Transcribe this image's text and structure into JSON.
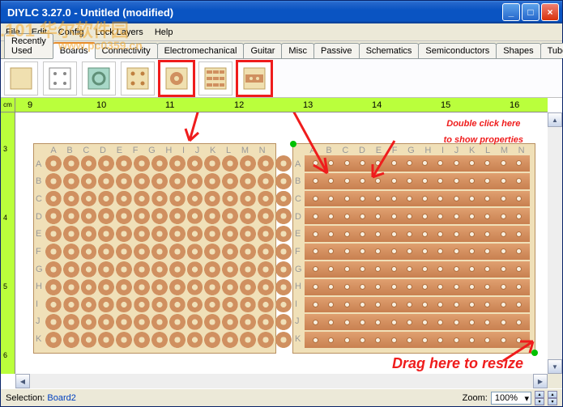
{
  "window": {
    "title": "DIYLC 3.27.0 - Untitled  (modified)"
  },
  "watermark": ".101 华尔软件园",
  "url_watermark": "www.pc0359.cn",
  "menu": [
    "File",
    "Edit",
    "Config",
    "Lock Layers",
    "Help"
  ],
  "tabs": [
    "Recently Used",
    "Boards",
    "Connectivity",
    "Electromechanical",
    "Guitar",
    "Misc",
    "Passive",
    "Schematics",
    "Semiconductors",
    "Shapes",
    "Tubes"
  ],
  "active_tab": "Boards",
  "ruler_unit": "cm",
  "ruler_h": [
    "9",
    "10",
    "11",
    "12",
    "13",
    "14",
    "15",
    "16"
  ],
  "ruler_v": [
    "3",
    "4",
    "5",
    "6"
  ],
  "col_letters": [
    "A",
    "B",
    "C",
    "D",
    "E",
    "F",
    "G",
    "H",
    "I",
    "J",
    "K",
    "L",
    "M",
    "N"
  ],
  "row_letters": [
    "A",
    "B",
    "C",
    "D",
    "E",
    "F",
    "G",
    "H",
    "I",
    "J",
    "K"
  ],
  "annotations": {
    "dbl": "Double click here\nto show properties",
    "drag": "Drag here to resize"
  },
  "status": {
    "selection_label": "Selection:",
    "selection_value": "Board2",
    "zoom_label": "Zoom:",
    "zoom_value": "100%"
  }
}
